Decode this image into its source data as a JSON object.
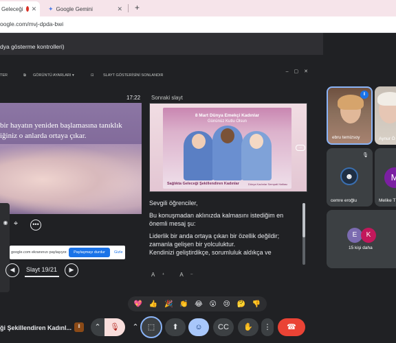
{
  "browser": {
    "tabs": [
      {
        "label": "Geleceği",
        "active": true
      },
      {
        "label": "Google Gemini",
        "active": false
      }
    ],
    "new_tab": "+",
    "url": "oogle.com/mvj-dpda-bwi"
  },
  "control_window": {
    "title": "dya gösterme kontrolleri)",
    "toolbar": {
      "left": "TER",
      "view_settings": "GÖRÜNTÜ AYARLARI ▾",
      "end_slideshow": "SLAYT GÖSTERİSİNİ SONLANDIR"
    },
    "clock": "17:22",
    "current_slide_text": "bir hayatın yeniden başlamasına tanıklık iğiniz o anlarda ortaya çıkar.",
    "next_slide_label": "Sonraki slayt",
    "next_slide": {
      "title": "8 Mart Dünya Emekçi Kadınlar",
      "subtitle": "Gününüz Kutlu Olsun",
      "footer": "Sağlıkta Geleceği Şekillendiren Kadınlar",
      "footer_small": "Dünya Kadınlar Sempati Haftası"
    },
    "notes": [
      "Sevgili öğrenciler,",
      "Bu konuşmadan aklınızda kalmasını istediğim en önemli mesaj şu:",
      "Liderlik bir anda ortaya çıkan bir özellik değildir; zamanla gelişen bir yolculuktur.",
      "Kendinizi geliştirdikçe, sorumluluk aldıkça ve"
    ],
    "font_buttons": [
      "A⁺",
      "A⁻"
    ],
    "share_bar": {
      "text": "google.com ekranınızı paylaşıyor.",
      "stop": "Paylaşmayı durdur",
      "hide": "Gizle"
    },
    "slide_counter": "Slayt 19/21"
  },
  "participants": [
    {
      "name": "ebru temizsoy",
      "speaking": true
    },
    {
      "name": "Aynur Ö"
    },
    {
      "name": "cemre eroğlu",
      "muted": true
    },
    {
      "name": "Melike T",
      "initial": "M"
    }
  ],
  "more_people": {
    "initials": [
      "E",
      "K"
    ],
    "label": "15 kişi daha"
  },
  "reactions": [
    "💖",
    "👍",
    "🎉",
    "👏",
    "😂",
    "😮",
    "😢",
    "🤔",
    "👎"
  ],
  "bottom": {
    "meeting_title": "ği Şekillendiren Kadınl...",
    "hand_badge": "ll"
  },
  "colors": {
    "accent": "#8ab4f8",
    "end_call": "#ea4335",
    "slide_purple": "#7d6596"
  }
}
